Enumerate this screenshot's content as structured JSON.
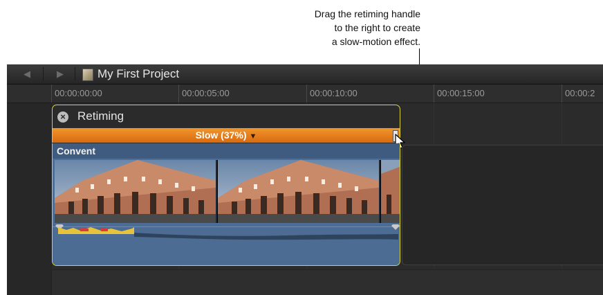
{
  "callout": {
    "lines": [
      "Drag the retiming handle",
      "to the right to create",
      "a slow-motion effect."
    ]
  },
  "toolbar": {
    "back_icon": "back-arrow-icon",
    "forward_icon": "forward-arrow-icon",
    "project_title": "My First Project"
  },
  "ruler": {
    "labels": [
      "00:00:00:00",
      "00:00:05:00",
      "00:00:10:00",
      "00:00:15:00",
      "00:00:2"
    ]
  },
  "retiming": {
    "title": "Retiming",
    "speed_label": "Slow (37%)",
    "speed_arrow": "▼"
  },
  "clip": {
    "name": "Convent"
  },
  "colors": {
    "selection": "#d8d23a",
    "speed_bar": "#e8801e",
    "clip_blue": "#4d6e96"
  }
}
